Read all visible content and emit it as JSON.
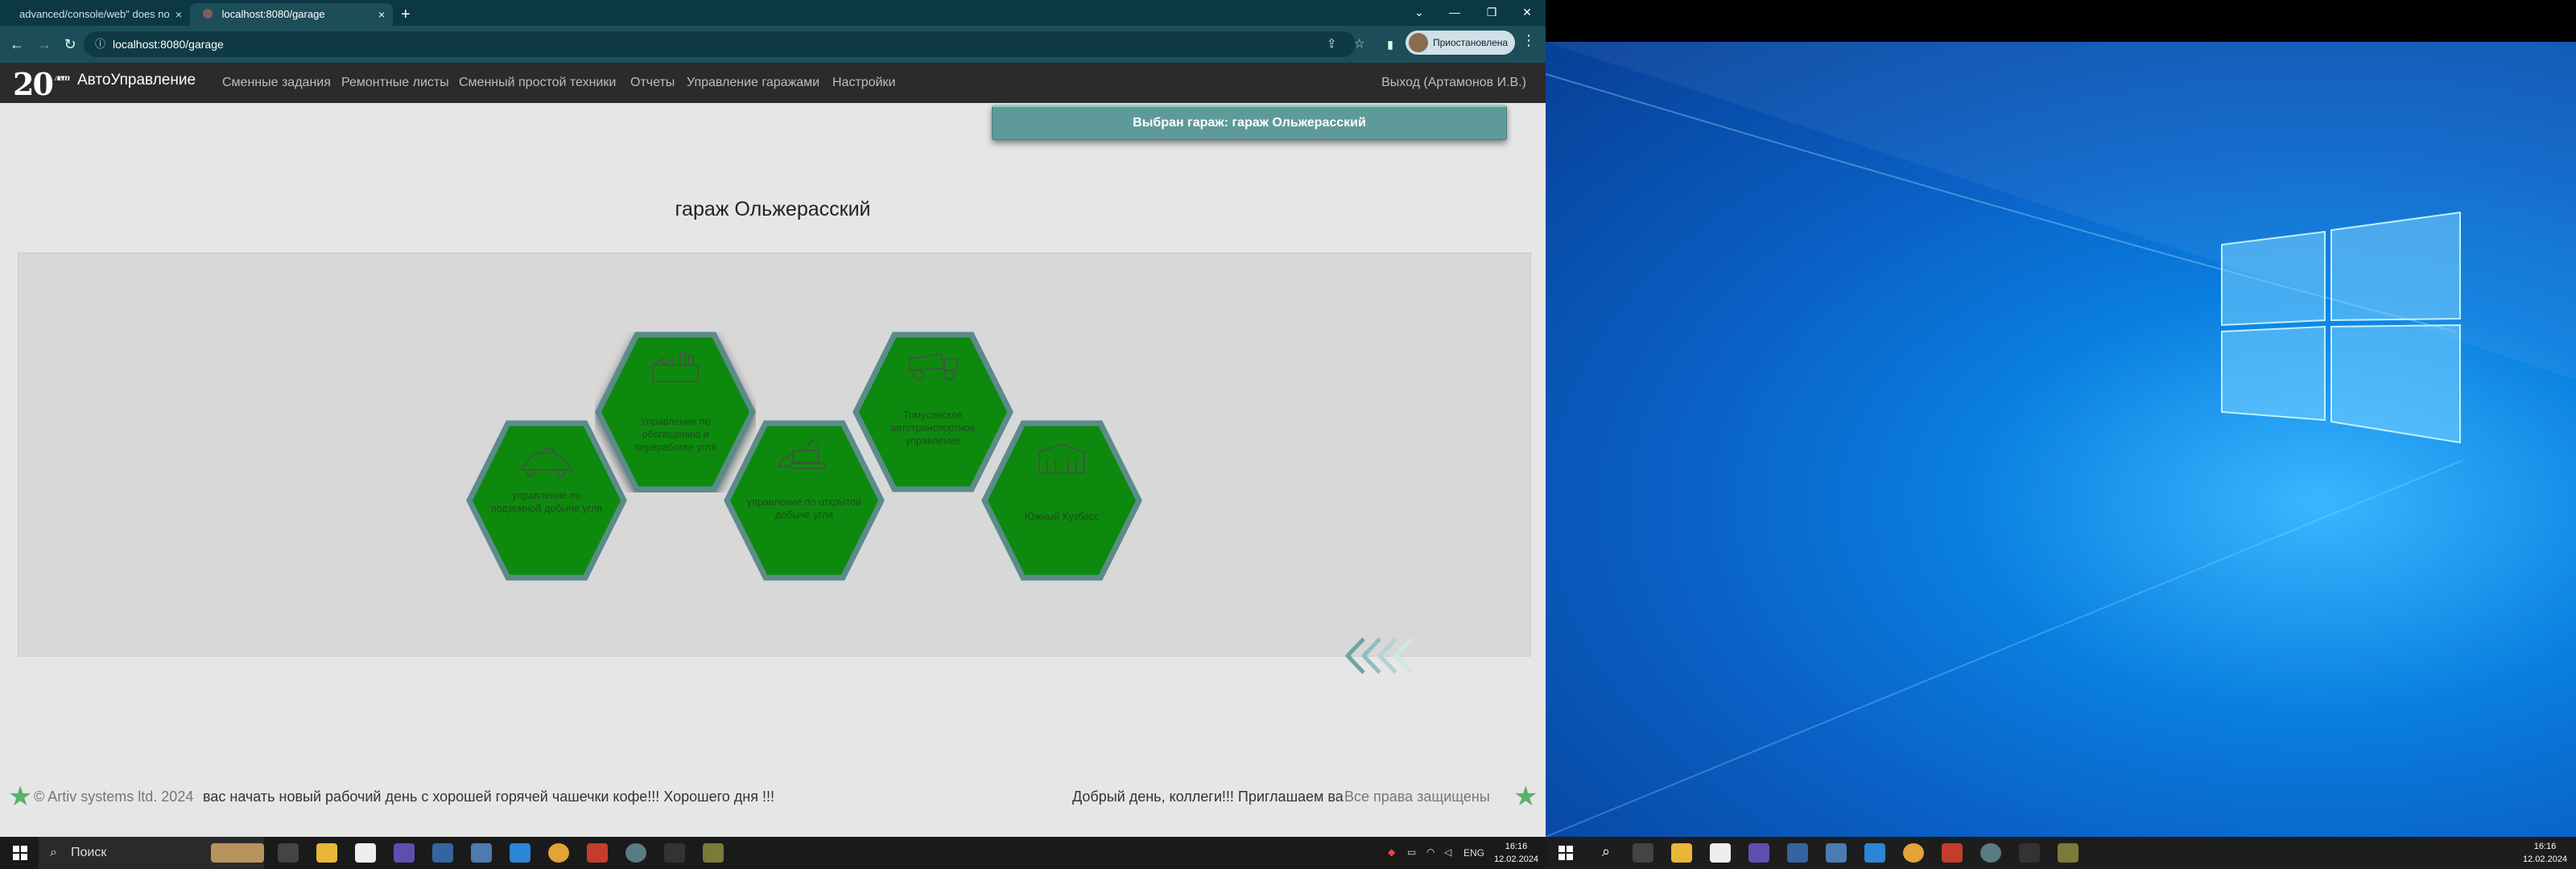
{
  "browser": {
    "tabs": [
      {
        "label": "advanced/console/web\" does no"
      },
      {
        "label": "localhost:8080/garage"
      }
    ],
    "url": "localhost:8080/garage",
    "profile_label": "Приостановлена"
  },
  "app": {
    "logo_text": "20",
    "brand": "АвтоУправление",
    "nav": [
      {
        "label": "Сменные задания"
      },
      {
        "label": "Ремонтные листы"
      },
      {
        "label": "Сменный простой техники"
      },
      {
        "label": "Отчеты"
      },
      {
        "label": "Управление гаражами"
      },
      {
        "label": "Настройки"
      }
    ],
    "logout": "Выход (Артамонов И.В.)",
    "toast": "Выбран гараж: гараж Ольжерасский",
    "garage_title": "гараж Ольжерасский",
    "hexes": [
      {
        "label": "управление по подземной добыче угля",
        "icon": "mining-machine-icon",
        "selected": false
      },
      {
        "label": "Управление по обогащению и переработке угля",
        "icon": "factory-icon",
        "selected": true
      },
      {
        "label": "управление по открытой добыче угля",
        "icon": "excavator-icon",
        "selected": false
      },
      {
        "label": "Томусинское автотранспортное управление",
        "icon": "dump-truck-icon",
        "selected": false
      },
      {
        "label": "Южный Кузбасс",
        "icon": "building-icon",
        "selected": false
      }
    ],
    "hex_color": "#0d8a0d",
    "hex_border": "#5b8b8b",
    "footer": {
      "copyright": "© Artiv systems ltd. 2024",
      "ticker_left": "вас начать новый рабочий день с хорошей горячей чашечки кофе!!! Хорошего дня !!!",
      "ticker_right": "Добрый день, коллеги!!! Приглашаем ва",
      "rights": "Все права защищены"
    }
  },
  "taskbar_left": {
    "search_placeholder": "Поиск",
    "lang": "ENG",
    "time": "16:16",
    "date": "12.02.2024"
  },
  "taskbar_right": {
    "time": "16:16",
    "date": "12.02.2024"
  }
}
